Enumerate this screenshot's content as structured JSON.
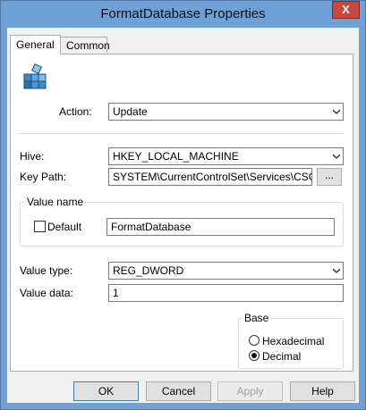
{
  "window": {
    "title": "FormatDatabase Properties",
    "close_label": "X"
  },
  "tabs": [
    {
      "label": "General",
      "active": true
    },
    {
      "label": "Common",
      "active": false
    }
  ],
  "general": {
    "action": {
      "label": "Action:",
      "value": "Update"
    },
    "hive": {
      "label": "Hive:",
      "value": "HKEY_LOCAL_MACHINE"
    },
    "key_path": {
      "label": "Key Path:",
      "value": "SYSTEM\\CurrentControlSet\\Services\\CSC\\Parar",
      "browse_label": "..."
    },
    "value_name": {
      "group_label": "Value name",
      "default_label": "Default",
      "default_checked": false,
      "value": "FormatDatabase"
    },
    "value_type": {
      "label": "Value type:",
      "value": "REG_DWORD"
    },
    "value_data": {
      "label": "Value data:",
      "value": "1"
    },
    "base": {
      "group_label": "Base",
      "options": [
        {
          "label": "Hexadecimal",
          "checked": false
        },
        {
          "label": "Decimal",
          "checked": true
        }
      ]
    }
  },
  "buttons": {
    "ok": "OK",
    "cancel": "Cancel",
    "apply": "Apply",
    "help": "Help"
  }
}
